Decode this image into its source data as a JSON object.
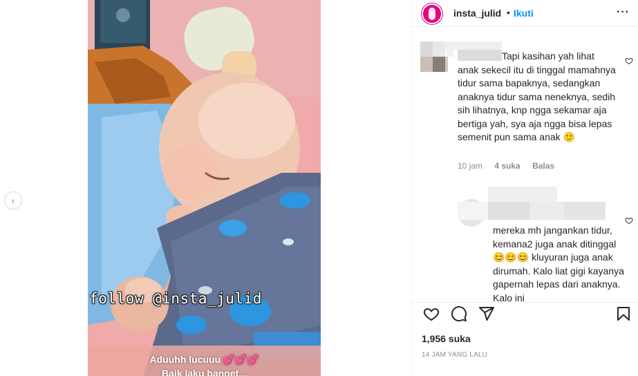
{
  "post": {
    "username": "insta_julid",
    "follow_label": "Ikuti",
    "separator": "•",
    "more_label": "···",
    "media": {
      "prev_icon": "chevron-left-icon",
      "overlay_follow": "follow @insta_julid",
      "overlay_caption_line1": "Aduuhh lucuuu",
      "overlay_caption_hearts": "💕💕💕",
      "overlay_caption_line2": "Baik laku banget..."
    }
  },
  "comments": [
    {
      "text_first": "Tapi kasihan yah lihat",
      "text_rest": "anak sekecil itu di tinggal mamahnya tidur sama bapaknya, sedangkan anaknya tidur sama neneknya, sedih sih lihatnya, knp ngga sekamar aja bertiga yah, sya aja ngga bisa lepas semenit pun sama anak 🙂",
      "time": "10 jam",
      "likes": "4 suka",
      "reply": "Balas"
    },
    {
      "text": "mereka mh jangankan tidur, kemana2 juga anak ditinggal😊😊😊 kluyuran juga anak dirumah. Kalo liat gigi kayanya gapernah lepas dari anaknya. Kalo ini"
    }
  ],
  "actions": {
    "like_icon": "heart-icon",
    "comment_icon": "comment-icon",
    "share_icon": "send-icon",
    "save_icon": "bookmark-icon"
  },
  "likes_count": "1,956 suka",
  "timestamp": "14 JAM YANG LALU",
  "colors": {
    "accent": "#0095f6",
    "avatar_ring": "#e7007e",
    "background_pink": "#f0a9a8",
    "pillow_blue": "#5b6a8a"
  }
}
